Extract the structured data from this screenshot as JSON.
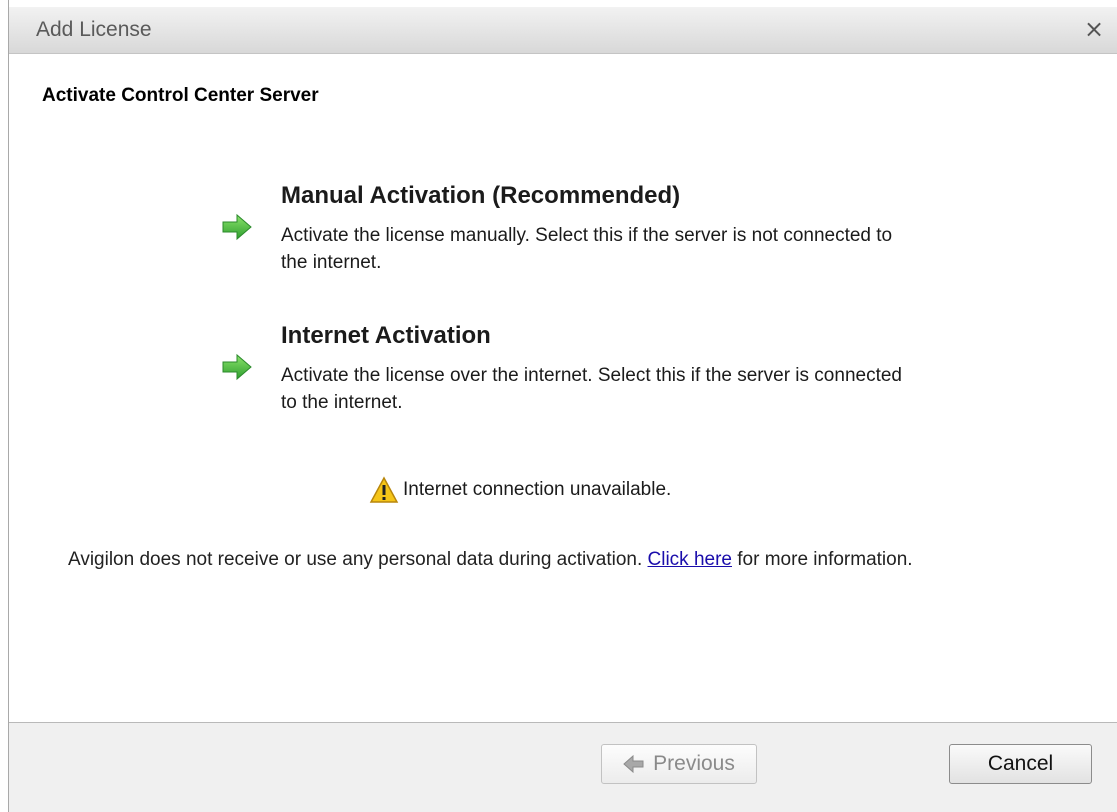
{
  "dialog": {
    "title": "Add License",
    "close_glyph": "×"
  },
  "content": {
    "heading": "Activate Control Center Server",
    "options": [
      {
        "title": "Manual Activation (Recommended)",
        "description": "Activate the license manually.  Select this if the server is not connected to the internet.",
        "icon": "green-arrow-right-icon"
      },
      {
        "title": "Internet Activation",
        "description": "Activate the license over the internet.  Select this if the server is connected to the internet.",
        "icon": "green-arrow-right-icon"
      }
    ],
    "warning": {
      "icon": "warning-icon",
      "text": "Internet connection unavailable."
    },
    "privacy": {
      "before_link": "Avigilon does not receive or use any personal data during activation. ",
      "link_text": "Click here",
      "after_link": " for more information."
    }
  },
  "footer": {
    "previous_label": "Previous",
    "cancel_label": "Cancel"
  },
  "colors": {
    "arrow_green": "#3fbf3f",
    "link_blue": "#1a0dab",
    "warning_yellow": "#f5c518"
  }
}
